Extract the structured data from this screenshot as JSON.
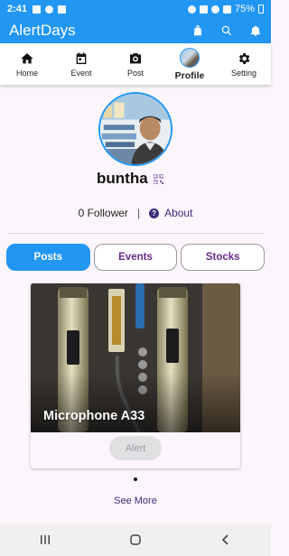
{
  "status_bar": {
    "time": "2:41",
    "battery": "75%"
  },
  "app_bar": {
    "title": "AlertDays"
  },
  "nav_tabs": [
    {
      "label": "Home",
      "icon": "home-icon"
    },
    {
      "label": "Event",
      "icon": "calendar-icon"
    },
    {
      "label": "Post",
      "icon": "camera-icon"
    },
    {
      "label": "Profile",
      "icon": "avatar-icon",
      "active": true
    },
    {
      "label": "Setting",
      "icon": "gear-icon"
    }
  ],
  "profile": {
    "username": "buntha",
    "follower_text": "0 Follower",
    "separator": "|",
    "about_label": "About"
  },
  "content_tabs": [
    {
      "label": "Posts",
      "active": true
    },
    {
      "label": "Events"
    },
    {
      "label": "Stocks"
    }
  ],
  "post_card": {
    "title": "Microphone A33",
    "alert_button": "Alert"
  },
  "see_more": "See More",
  "colors": {
    "primary": "#2196f3",
    "accent_text": "#6a2a8c",
    "link_text": "#3a2e7a"
  }
}
